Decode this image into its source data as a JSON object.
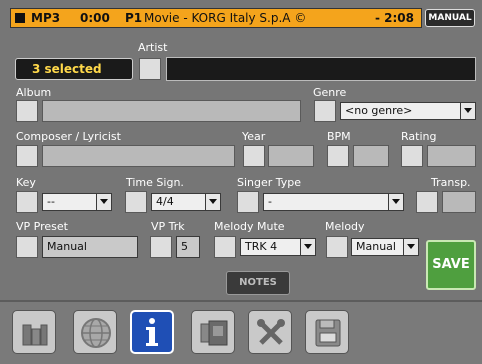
{
  "status": {
    "type": "MP3",
    "time": "0:00",
    "slot": "P1",
    "song_title": "Movie - KORG Italy S.p.A ©",
    "remaining": "- 2:08",
    "mode": "MANUAL"
  },
  "selection": {
    "label": "3 selected"
  },
  "fields": {
    "artist": {
      "label": "Artist",
      "value": ""
    },
    "album": {
      "label": "Album",
      "value": ""
    },
    "genre": {
      "label": "Genre",
      "value": "<no genre>"
    },
    "composer": {
      "label": "Composer / Lyricist",
      "value": ""
    },
    "year": {
      "label": "Year",
      "value": ""
    },
    "bpm": {
      "label": "BPM",
      "value": ""
    },
    "rating": {
      "label": "Rating",
      "value": ""
    },
    "key": {
      "label": "Key",
      "value": "--"
    },
    "time_sign": {
      "label": "Time Sign.",
      "value": "4/4"
    },
    "singer_type": {
      "label": "Singer Type",
      "value": "-"
    },
    "transp": {
      "label": "Transp.",
      "value": ""
    },
    "vp_preset": {
      "label": "VP Preset",
      "value": "Manual"
    },
    "vp_trk": {
      "label": "VP Trk",
      "value": "5"
    },
    "melody_mute": {
      "label": "Melody Mute",
      "value": "TRK 4"
    },
    "melody": {
      "label": "Melody",
      "value": "Manual"
    }
  },
  "buttons": {
    "notes": "NOTES",
    "save": "SAVE"
  },
  "tabs": [
    {
      "name": "tab-player",
      "icon": "player-icon"
    },
    {
      "name": "tab-web",
      "icon": "globe-icon"
    },
    {
      "name": "tab-info",
      "icon": "info-icon"
    },
    {
      "name": "tab-copy",
      "icon": "copy-icon"
    },
    {
      "name": "tab-tools",
      "icon": "tools-icon"
    },
    {
      "name": "tab-save",
      "icon": "floppy-icon"
    }
  ],
  "colors": {
    "status_bar": "#f4a41c",
    "selected_text": "#ffd84a",
    "save": "#4f9f3f",
    "active_tab": "#1f4fb5"
  }
}
